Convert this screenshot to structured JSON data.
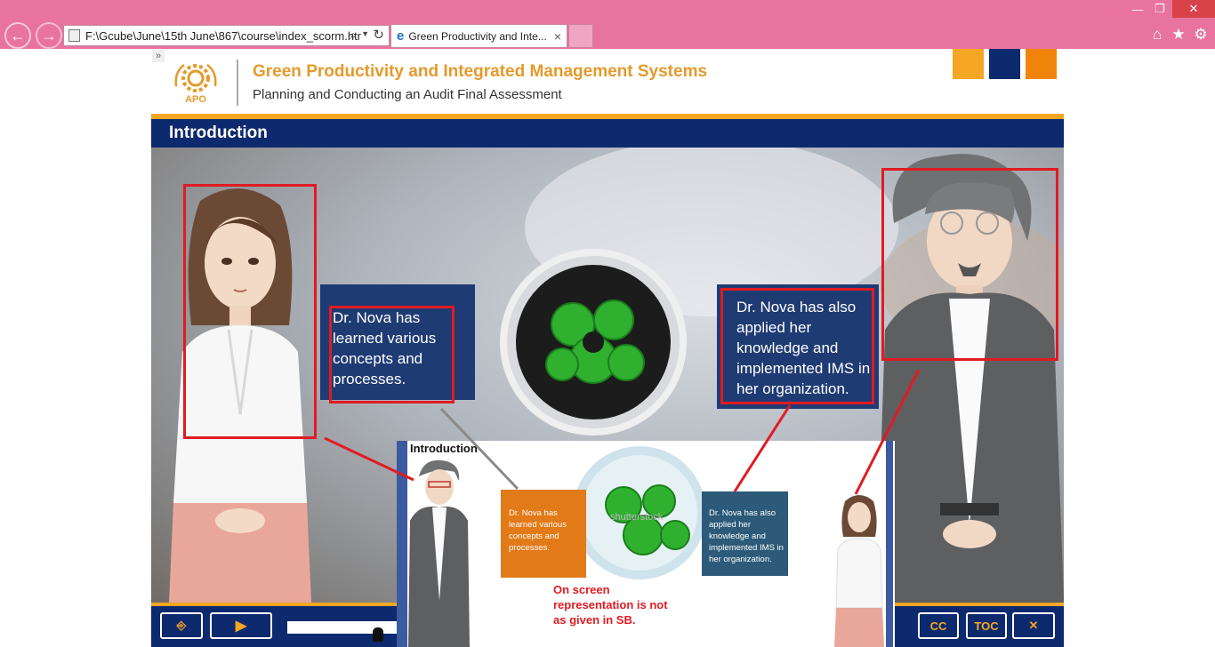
{
  "browser": {
    "address": "F:\\Gcube\\June\\15th June\\867\\course\\index_scorm.htr",
    "tab_label": "Green Productivity and Inte...",
    "tab_close": "×"
  },
  "course": {
    "logo_text": "APO",
    "title": "Green Productivity and Integrated Management Systems",
    "subtitle": "Planning and Conducting an Audit Final Assessment",
    "header_colors": [
      "#f5a623",
      "#0e2a6e",
      "#f0840a"
    ]
  },
  "section": {
    "title": "Introduction"
  },
  "slide": {
    "caption_left": "Dr. Nova has learned various concepts and processes.",
    "caption_right": "Dr. Nova has also applied her knowledge and implemented IMS in her organization."
  },
  "navbar": {
    "exit_label": "⎆",
    "play_label": "▶",
    "cc_label": "CC",
    "toc_label": "TOC",
    "close_label": "✕"
  },
  "overlay": {
    "title": "Introduction",
    "caption_left": "Dr. Nova has learned various concepts and processes.",
    "caption_right": "Dr. Nova has also applied her knowledge and implemented IMS in her organization.",
    "watermark": "shutterstock",
    "note": "On screen representation is not as given in SB."
  }
}
